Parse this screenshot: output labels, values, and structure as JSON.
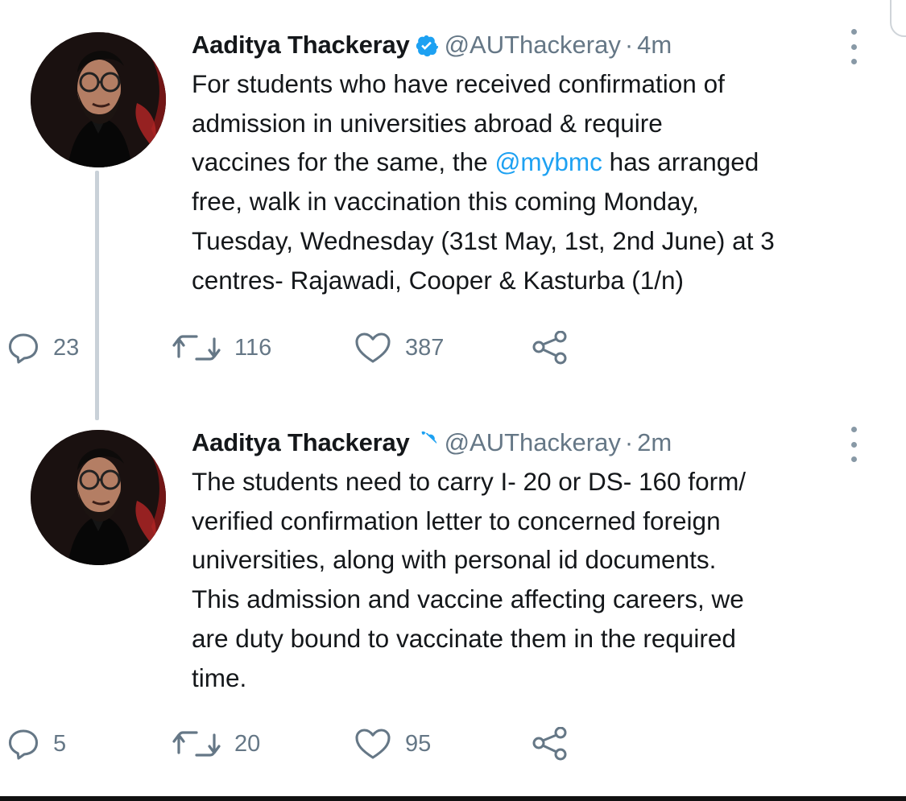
{
  "tweets": [
    {
      "name": "Aaditya Thackeray",
      "handle": "@AUThackeray",
      "separator": "·",
      "time": "4m",
      "text_lines": [
        "For students who have received confirmation of",
        "admission in universities abroad & require",
        "vaccines for the same, the ",
        "free, walk in vaccination this coming Monday,",
        "Tuesday, Wednesday (31st May, 1st, 2nd June) at 3",
        "centres- Rajawadi, Cooper & Kasturba (1/n)"
      ],
      "mention": "@mybmc",
      "mention_after": " has arranged",
      "stats": {
        "replies": "23",
        "retweets": "116",
        "likes": "387"
      }
    },
    {
      "name": "Aaditya Thackeray",
      "handle": "@AUThackeray",
      "separator": "·",
      "time": "2m",
      "text_lines": [
        "The students need to carry I- 20 or DS- 160 form/",
        "verified confirmation letter to concerned foreign",
        "universities, along with personal id documents.",
        "This admission and vaccine affecting careers, we",
        "are duty bound to vaccinate them in the required",
        "time."
      ],
      "stats": {
        "replies": "5",
        "retweets": "20",
        "likes": "95"
      }
    }
  ],
  "icons": {
    "verified": "verified-badge-icon",
    "more": "more-vertical-icon",
    "reply": "reply-bubble-icon",
    "retweet": "retweet-icon",
    "like": "heart-icon",
    "share": "share-icon"
  },
  "colors": {
    "text": "#14171a",
    "secondary": "#657786",
    "mention": "#1da1f2",
    "thread_line": "#c9d1d8"
  }
}
